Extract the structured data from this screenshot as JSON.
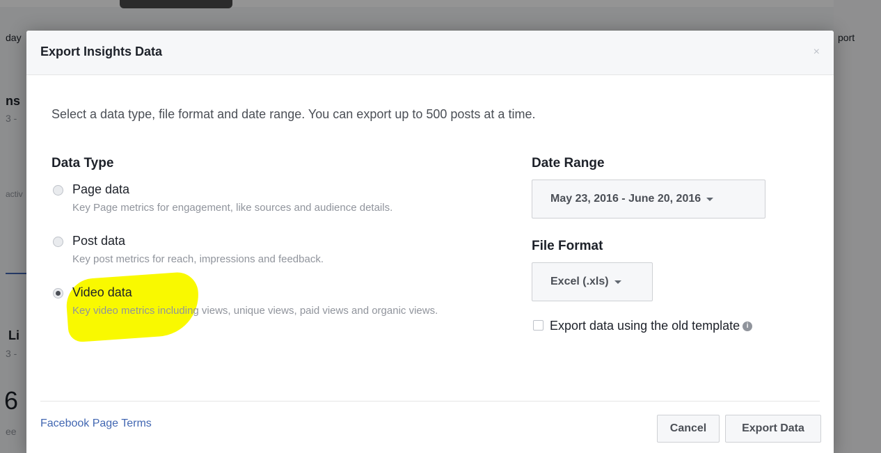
{
  "background": {
    "left_texts": [
      "day",
      "ns",
      "3 -",
      "activ",
      "Li",
      "3 -",
      "6",
      "ee"
    ],
    "right_text": "port"
  },
  "dialog": {
    "title": "Export Insights Data",
    "close_glyph": "×",
    "intro": "Select a data type, file format and date range. You can export up to 500 posts at a time.",
    "data_type": {
      "heading": "Data Type",
      "options": [
        {
          "label": "Page data",
          "description": "Key Page metrics for engagement, like sources and audience details.",
          "checked": false
        },
        {
          "label": "Post data",
          "description": "Key post metrics for reach, impressions and feedback.",
          "checked": false
        },
        {
          "label": "Video data",
          "description": "Key video metrics including views, unique views, paid views and organic views.",
          "checked": true
        }
      ]
    },
    "date_range": {
      "heading": "Date Range",
      "value": "May 23, 2016 - June 20, 2016"
    },
    "file_format": {
      "heading": "File Format",
      "value": "Excel (.xls)"
    },
    "old_template": {
      "label": "Export data using the old template",
      "checked": false,
      "info_glyph": "i"
    },
    "footer": {
      "terms_link": "Facebook Page Terms",
      "cancel_label": "Cancel",
      "export_label": "Export Data"
    }
  },
  "colors": {
    "highlight": "#f9f900",
    "link": "#4267b2",
    "overlay": "rgba(0,0,0,0.42)"
  }
}
